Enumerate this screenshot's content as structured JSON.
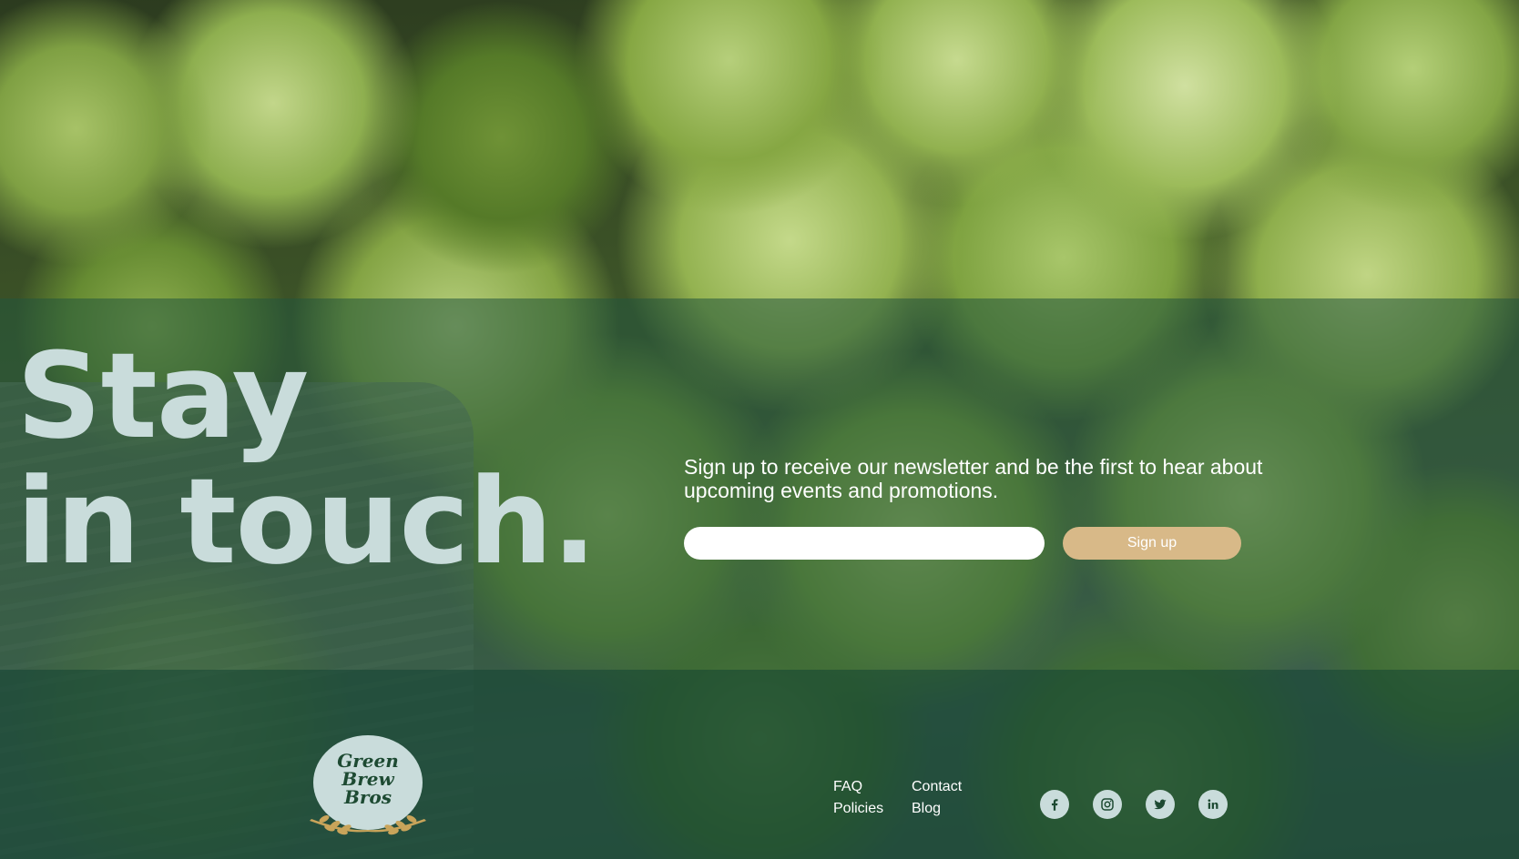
{
  "hero": {
    "headline_line1": "Stay",
    "headline_line2": "in touch."
  },
  "newsletter": {
    "text": "Sign up to receive our newsletter and be the first to hear about upcoming events and promotions.",
    "email_value": "",
    "email_placeholder": "",
    "signup_label": "Sign up"
  },
  "footer": {
    "logo": {
      "line1": "Green",
      "line2": "Brew",
      "line3": "Bros"
    },
    "links": {
      "faq": "FAQ",
      "policies": "Policies",
      "contact": "Contact",
      "blog": "Blog"
    },
    "social_icons": [
      "facebook-icon",
      "instagram-icon",
      "twitter-icon",
      "linkedin-icon"
    ]
  },
  "colors": {
    "headline": "#c9dcdb",
    "signup_button": "#d8b988",
    "footer_band": "#16483a",
    "newsletter_band": "#22563c",
    "icon_circle": "#c9dcdb",
    "icon_glyph": "#1d4a32"
  }
}
